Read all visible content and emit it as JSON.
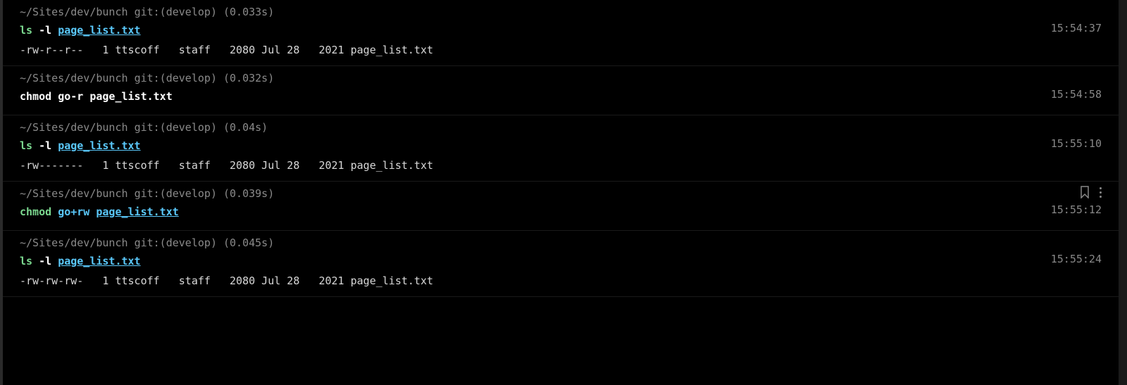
{
  "blocks": [
    {
      "prompt": {
        "path": "~/Sites/dev/bunch",
        "git_prefix": "git:(",
        "branch": "develop",
        "git_suffix": ")",
        "timing": "(0.033s)"
      },
      "command": {
        "cmd": "ls",
        "flag": "-l",
        "arg": "page_list.txt",
        "arg_style": "cyan-underline"
      },
      "output": "-rw-r--r--   1 ttscoff   staff   2080 Jul 28   2021 page_list.txt",
      "timestamp": "15:54:37",
      "show_actions": false
    },
    {
      "prompt": {
        "path": "~/Sites/dev/bunch",
        "git_prefix": "git:(",
        "branch": "develop",
        "git_suffix": ")",
        "timing": "(0.032s)"
      },
      "command": {
        "cmd": "chmod",
        "flag": "go-r",
        "arg": "page_list.txt",
        "arg_style": "white",
        "cmd_white": true
      },
      "output": "",
      "timestamp": "15:54:58",
      "show_actions": false
    },
    {
      "prompt": {
        "path": "~/Sites/dev/bunch",
        "git_prefix": "git:(",
        "branch": "develop",
        "git_suffix": ")",
        "timing": "(0.04s)"
      },
      "command": {
        "cmd": "ls",
        "flag": "-l",
        "arg": "page_list.txt",
        "arg_style": "cyan-underline"
      },
      "output": "-rw-------   1 ttscoff   staff   2080 Jul 28   2021 page_list.txt",
      "timestamp": "15:55:10",
      "show_actions": false
    },
    {
      "prompt": {
        "path": "~/Sites/dev/bunch",
        "git_prefix": "git:(",
        "branch": "develop",
        "git_suffix": ")",
        "timing": "(0.039s)"
      },
      "command": {
        "cmd": "chmod",
        "flag": "go+rw",
        "arg": "page_list.txt",
        "arg_style": "cyan-underline"
      },
      "output": "",
      "timestamp": "15:55:12",
      "show_actions": true
    },
    {
      "prompt": {
        "path": "~/Sites/dev/bunch",
        "git_prefix": "git:(",
        "branch": "develop",
        "git_suffix": ")",
        "timing": "(0.045s)"
      },
      "command": {
        "cmd": "ls",
        "flag": "-l",
        "arg": "page_list.txt",
        "arg_style": "cyan-underline"
      },
      "output": "-rw-rw-rw-   1 ttscoff   staff   2080 Jul 28   2021 page_list.txt",
      "timestamp": "15:55:24",
      "show_actions": false
    }
  ]
}
